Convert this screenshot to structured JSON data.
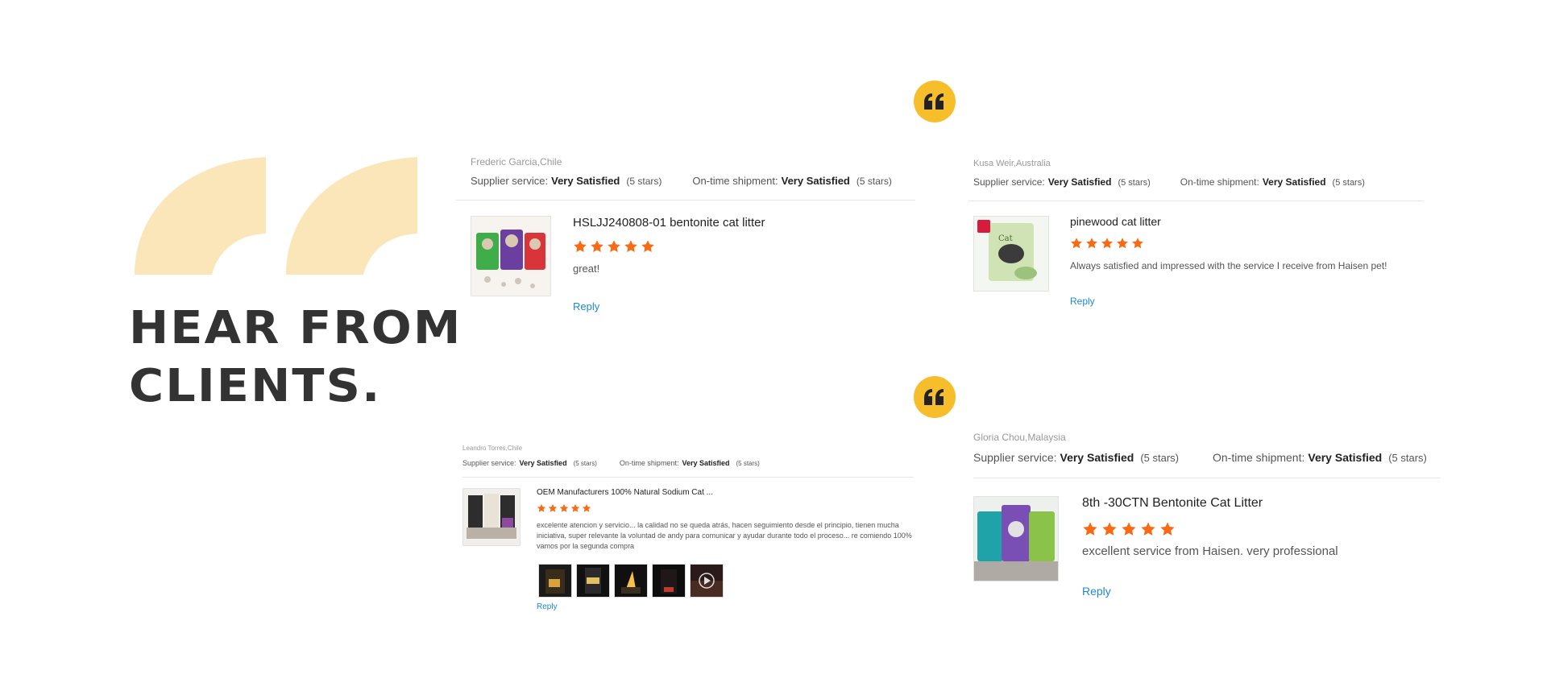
{
  "section": {
    "heading_line1": "HEAR FROM",
    "heading_line2": "CLIENTS."
  },
  "colors": {
    "accent_yellow": "#f7be2b",
    "quote_light": "#fae6b9",
    "star_orange": "#f96a14",
    "link_blue": "#1e88d5"
  },
  "icons": {
    "quote_badge": "quote-icon",
    "star": "star-icon",
    "play": "play-icon"
  },
  "reviews": [
    {
      "reviewer": "Frederic Garcia,Chile",
      "supplier_label": "Supplier service:",
      "supplier_value": "Very Satisfied",
      "supplier_stars": "(5 stars)",
      "shipment_label": "On-time shipment:",
      "shipment_value": "Very Satisfied",
      "shipment_stars": "(5 stars)",
      "product": "HSLJJ240808-01 bentonite cat litter",
      "rating": 5,
      "comment": "great!",
      "reply": "Reply"
    },
    {
      "reviewer": "Kusa Weir,Australia",
      "supplier_label": "Supplier service:",
      "supplier_value": "Very Satisfied",
      "supplier_stars": "(5 stars)",
      "shipment_label": "On-time shipment:",
      "shipment_value": "Very Satisfied",
      "shipment_stars": "(5 stars)",
      "product": "pinewood cat litter",
      "rating": 5,
      "comment": "Always satisfied and impressed with the service I receive from Haisen pet!",
      "reply": "Reply"
    },
    {
      "reviewer": "Leandro Torres,Chile",
      "supplier_label": "Supplier service:",
      "supplier_value": "Very Satisfied",
      "supplier_stars": "(5 stars)",
      "shipment_label": "On-time shipment:",
      "shipment_value": "Very Satisfied",
      "shipment_stars": "(5 stars)",
      "product": "OEM Manufacturers 100% Natural Sodium Cat ...",
      "rating": 5,
      "comment": "excelente atencion y servicio... la calidad no se queda atrás, hacen seguimiento desde el principio, tienen mucha iniciativa, super relevante la voluntad de andy para comunicar y ayudar durante todo el proceso... re comiendo 100% vamos por la segunda compra",
      "photos_count": 5,
      "reply": "Reply"
    },
    {
      "reviewer": "Gloria Chou,Malaysia",
      "supplier_label": "Supplier service:",
      "supplier_value": "Very Satisfied",
      "supplier_stars": "(5 stars)",
      "shipment_label": "On-time shipment:",
      "shipment_value": "Very Satisfied",
      "shipment_stars": "(5 stars)",
      "product": "8th -30CTN Bentonite Cat Litter",
      "rating": 5,
      "comment": "excellent service from Haisen. very professional",
      "reply": "Reply"
    }
  ]
}
